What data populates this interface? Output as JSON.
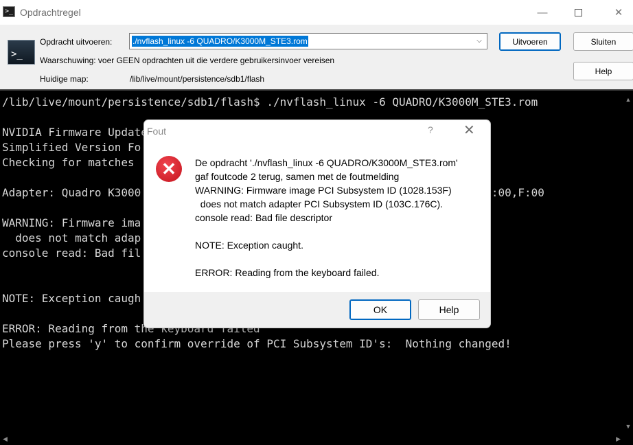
{
  "window": {
    "title": "Opdrachtregel",
    "app_icon_glyph": ">_",
    "minimize_glyph": "—",
    "close_glyph": "✕"
  },
  "toolbar": {
    "command_label": "Opdracht uitvoeren:",
    "command_value": "./nvflash_linux -6 QUADRO/K3000M_STE3.rom",
    "dropdown_glyph": "⌵",
    "warning_text": "Waarschuwing: voer GEEN opdrachten uit die verdere gebruikersinvoer vereisen",
    "dir_label": "Huidige map:",
    "dir_value": "/lib/live/mount/persistence/sdb1/flash",
    "run_label": "Uitvoeren",
    "close_label": "Sluiten",
    "help_label": "Help"
  },
  "console": {
    "text": "/lib/live/mount/persistence/sdb1/flash$ ./nvflash_linux -6 QUADRO/K3000M_STE3.rom\n\nNVIDIA Firmware Update\nSimplified Version Fo\nChecking for matches\n\nAdapter: Quadro K3000                                                   ,D:00,F:00\n\nWARNING: Firmware ima\n  does not match adap\nconsole read: Bad fil\n\n\nNOTE: Exception caugh\n\nERROR: Reading from the keyboard failed\nPlease press 'y' to confirm override of PCI Subsystem ID's:  Nothing changed!"
  },
  "dialog": {
    "title": "Fout",
    "help_glyph": "?",
    "close_glyph": "✕",
    "icon_glyph": "✕",
    "message": "De opdracht './nvflash_linux -6 QUADRO/K3000M_STE3.rom'\ngaf foutcode 2 terug, samen met de foutmelding\nWARNING: Firmware image PCI Subsystem ID (1028.153F)\n  does not match adapter PCI Subsystem ID (103C.176C).\nconsole read: Bad file descriptor\n\nNOTE: Exception caught.\n\nERROR: Reading from the keyboard failed.",
    "ok_label": "OK",
    "help_label": "Help"
  },
  "colors": {
    "accent": "#0078d7",
    "error_red": "#e81123",
    "console_bg": "#000000"
  }
}
